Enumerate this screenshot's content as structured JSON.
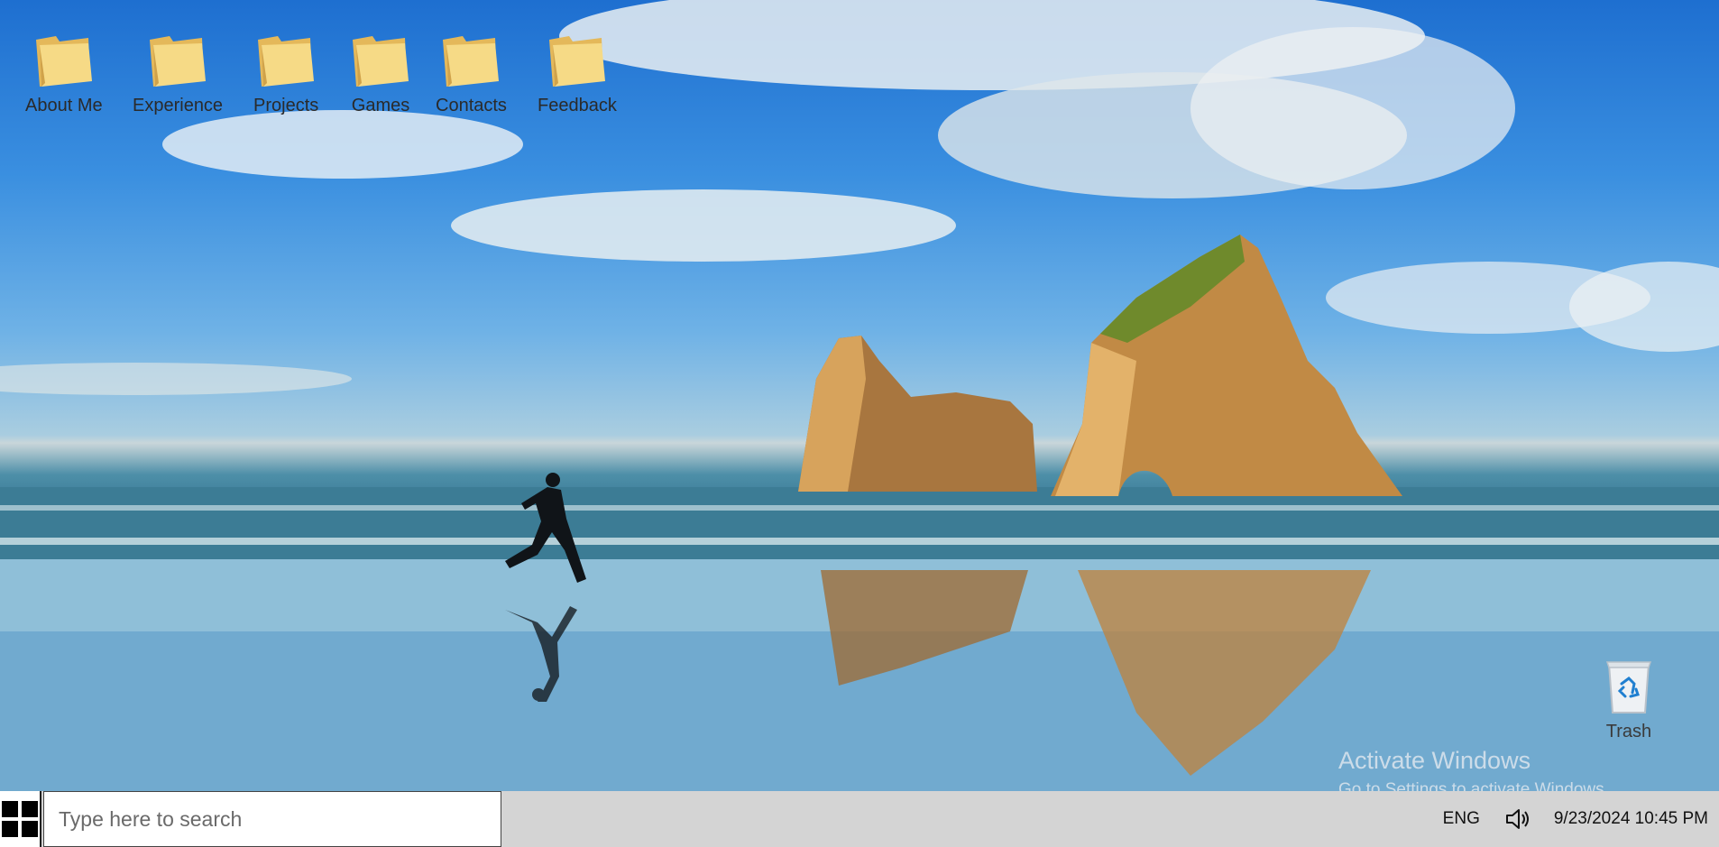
{
  "desktop": {
    "icons": [
      {
        "label": "About Me",
        "icon": "folder-icon"
      },
      {
        "label": "Experience",
        "icon": "folder-icon"
      },
      {
        "label": "Projects",
        "icon": "folder-icon"
      },
      {
        "label": "Games",
        "icon": "folder-icon"
      },
      {
        "label": "Contacts",
        "icon": "folder-icon"
      },
      {
        "label": "Feedback",
        "icon": "folder-icon"
      }
    ],
    "trash": {
      "label": "Trash",
      "icon": "recycle-bin-icon"
    },
    "watermark": {
      "title": "Activate Windows",
      "subtitle": "Go to Settings to activate Windows."
    }
  },
  "taskbar": {
    "start_icon": "windows-logo-icon",
    "search": {
      "placeholder": "Type here to search",
      "value": ""
    },
    "language": "ENG",
    "volume_icon": "speaker-icon",
    "clock": "9/23/2024 10:45 PM"
  },
  "colors": {
    "taskbar": "#d4d4d4",
    "folder": "#f3d27a",
    "sky": "#2f84dc"
  }
}
